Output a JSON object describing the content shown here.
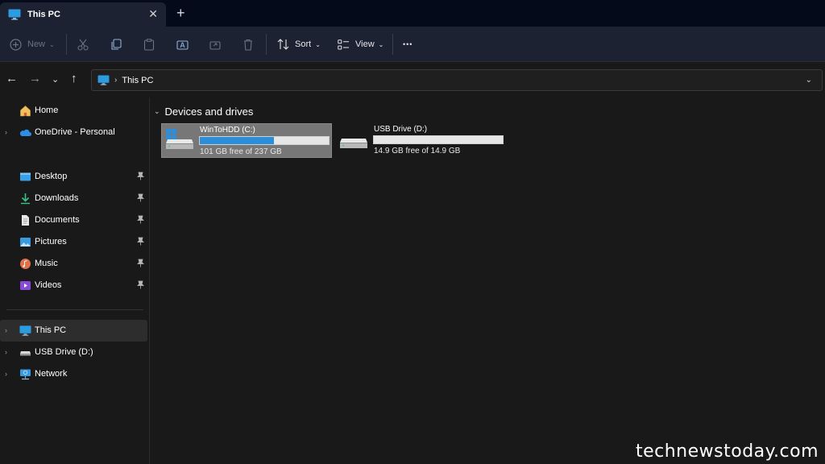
{
  "tab": {
    "title": "This PC",
    "close": "✕",
    "new_tab": "+"
  },
  "commands": {
    "new_label": "New",
    "sort_label": "Sort",
    "view_label": "View",
    "more": "•••"
  },
  "address": {
    "crumb": "This PC"
  },
  "sidebar": {
    "items": [
      {
        "label": "Home",
        "icon": "home-icon"
      },
      {
        "label": "OneDrive - Personal",
        "icon": "onedrive-icon"
      },
      {
        "label": "Desktop",
        "icon": "desktop-icon",
        "pinned": true
      },
      {
        "label": "Downloads",
        "icon": "downloads-icon",
        "pinned": true
      },
      {
        "label": "Documents",
        "icon": "documents-icon",
        "pinned": true
      },
      {
        "label": "Pictures",
        "icon": "pictures-icon",
        "pinned": true
      },
      {
        "label": "Music",
        "icon": "music-icon",
        "pinned": true
      },
      {
        "label": "Videos",
        "icon": "videos-icon",
        "pinned": true
      },
      {
        "label": "This PC",
        "icon": "this-pc-icon",
        "selected": true
      },
      {
        "label": "USB Drive (D:)",
        "icon": "usb-drive-icon"
      },
      {
        "label": "Network",
        "icon": "network-icon"
      }
    ]
  },
  "main": {
    "group_title": "Devices and drives",
    "drives": [
      {
        "name": "WinToHDD (C:)",
        "free_text": "101 GB free of 237 GB",
        "used_fraction": 0.574,
        "selected": true
      },
      {
        "name": "USB Drive (D:)",
        "free_text": "14.9 GB free of 14.9 GB",
        "used_fraction": 0.0,
        "selected": false
      }
    ]
  },
  "watermark": "technewstoday.com",
  "colors": {
    "accent": "#2c8ed8",
    "background": "#191919",
    "titlebar": "#050a1a",
    "toolbar": "#1c2232"
  }
}
